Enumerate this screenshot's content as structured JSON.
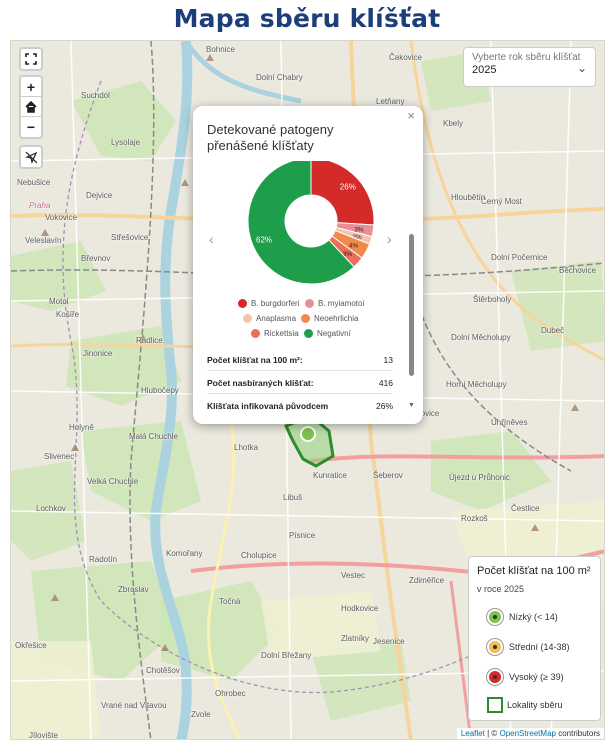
{
  "page": {
    "title": "Mapa sběru klíšťat"
  },
  "controls": {
    "fullscreen_icon": "fullscreen-icon",
    "zoom_in": "+",
    "home_icon": "home-icon",
    "zoom_out": "−",
    "locate_icon": "locate-off-icon"
  },
  "year_select": {
    "label": "Vyberte rok sběru klíšťat",
    "value": "2025"
  },
  "popup": {
    "title": "Detekované patogeny přenášené klíšťaty",
    "close": "×",
    "prev": "‹",
    "next": "›",
    "legend": [
      {
        "label": "B. burgdorferi",
        "color": "#d42a2a"
      },
      {
        "label": "B. myiamotoi",
        "color": "#e88e96"
      },
      {
        "label": "Anaplasma",
        "color": "#f5c2b0"
      },
      {
        "label": "Neoehrlichia",
        "color": "#f08a4b"
      },
      {
        "label": "Rickettsia",
        "color": "#eb6e5a"
      },
      {
        "label": "Negativní",
        "color": "#1e9e4b"
      }
    ],
    "stats": [
      {
        "label": "Počet klíšťat na 100 m²:",
        "value": "13"
      },
      {
        "label": "Počet nasbíraných klíšťat:",
        "value": "416"
      },
      {
        "label": "Klíšťata infikovaná původcem",
        "value": "26%"
      }
    ]
  },
  "chart_data": {
    "type": "pie",
    "categories": [
      "B. burgdorferi",
      "B. myiamotoi",
      "Anaplasma",
      "Neoehrlichia",
      "Rickettsia",
      "Negativní"
    ],
    "values": [
      26,
      3,
      2,
      4,
      3,
      62
    ],
    "labels": [
      "26%",
      "3%",
      "2%",
      "4%",
      "3%",
      "62%"
    ],
    "colors": [
      "#d42a2a",
      "#e88e96",
      "#f5c2b0",
      "#f08a4b",
      "#eb6e5a",
      "#1e9e4b"
    ]
  },
  "legend": {
    "title": "Počet klíšťat na 100 m²",
    "subtitle": "v roce 2025",
    "items": [
      {
        "label": "Nízký (< 14)",
        "color": "#7dc24b"
      },
      {
        "label": "Střední (14-38)",
        "color": "#f3bd4f"
      },
      {
        "label": "Vysoký (≥ 39)",
        "color": "#d42a2a"
      },
      {
        "label": "Lokality sběru",
        "color": "#2e8b2e"
      }
    ]
  },
  "attribution": {
    "leaflet": "Leaflet",
    "sep": " | © ",
    "osm": "OpenStreetMap",
    "suffix": " contributors"
  },
  "places": [
    "Suchdol",
    "Bohnice",
    "Dolní Chabry",
    "Čakovice",
    "Letňany",
    "Kbely",
    "Dejvice",
    "Vokovice",
    "Veleslavín",
    "Střešovice",
    "Břevnov",
    "Motol",
    "Košíře",
    "Jinonice",
    "Radlice",
    "Hlubočepy",
    "Holyně",
    "Malá Chuchle",
    "Slivenec",
    "Velká Chuchle",
    "Lochkov",
    "Radotín",
    "Komořany",
    "Zbraslav",
    "Točná",
    "Lhotka",
    "Libuš",
    "Písnice",
    "Kunratice",
    "Šeberov",
    "Újezd u Průhonic",
    "Dolní Měcholupy",
    "Štěrboholy",
    "Dubeč",
    "Horní Měcholupy",
    "Petrovice",
    "Uhříněves",
    "Běchovice",
    "Černý Most",
    "Hloubětín",
    "Dolní Počernice",
    "Jesenice",
    "Vestec",
    "Zdiměřice",
    "Hodkovice",
    "Zlatníky",
    "Dolní Břežany",
    "Ohrobec",
    "Zvole",
    "Chotěšov",
    "Cholupice",
    "Rozkoš",
    "Čestlice",
    "Nebušice",
    "Lysolaje",
    "Praha",
    "Jílovište",
    "Vrané nad Vltavou",
    "Okřešice"
  ]
}
